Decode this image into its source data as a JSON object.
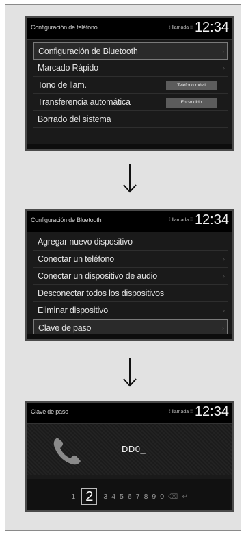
{
  "screens": [
    {
      "title": "Configuración de teléfono",
      "status": "⁞ llamada  ⁞⁞",
      "clock": "12:34",
      "items": [
        {
          "label": "Configuración de Bluetooth",
          "selected": true
        },
        {
          "label": "Marcado Rápido"
        },
        {
          "label": "Tono de llam.",
          "value": "Teléfono móvil"
        },
        {
          "label": "Transferencia automática",
          "value": "Encendido"
        },
        {
          "label": "Borrado del sistema"
        }
      ]
    },
    {
      "title": "Configuración de Bluetooth",
      "status": "⁞ llamada  ⁞⁞",
      "clock": "12:34",
      "items": [
        {
          "label": "Agregar nuevo dispositivo"
        },
        {
          "label": "Conectar un teléfono"
        },
        {
          "label": "Conectar un dispositivo de audio"
        },
        {
          "label": "Desconectar todos los dispositivos"
        },
        {
          "label": "Eliminar dispositivo"
        },
        {
          "label": "Clave de paso",
          "selected": true
        }
      ]
    },
    {
      "title": "Clave de paso",
      "status": "⁞ llamada  ⁞⁞",
      "clock": "12:34",
      "passkey_value": "DD0_",
      "keypad": {
        "keys": [
          "1",
          "2",
          "3",
          "4",
          "5",
          "6",
          "7",
          "8",
          "9",
          "0"
        ],
        "selected_key": "2",
        "delete_icon": "delete-icon",
        "enter_icon": "enter-icon"
      }
    }
  ],
  "arrows": [
    "down-arrow-icon",
    "down-arrow-icon"
  ],
  "colors": {
    "screen_bg": "#1a1a1a",
    "header_bg": "#000000",
    "frame_bg": "#e2e2e2",
    "value_box": "#5c5c5c"
  }
}
